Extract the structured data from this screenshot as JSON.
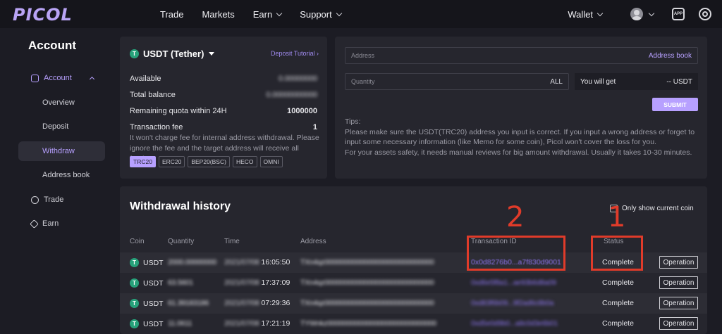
{
  "header": {
    "logo": "PICOL",
    "nav": [
      {
        "label": "Trade",
        "dropdown": false
      },
      {
        "label": "Markets",
        "dropdown": false
      },
      {
        "label": "Earn",
        "dropdown": true
      },
      {
        "label": "Support",
        "dropdown": true
      }
    ],
    "wallet_label": "Wallet",
    "app_icon_text": "APP"
  },
  "sidebar": {
    "title": "Account",
    "account_label": "Account",
    "items": [
      "Overview",
      "Deposit",
      "Withdraw",
      "Address book"
    ],
    "trade_label": "Trade",
    "earn_label": "Earn"
  },
  "coin_panel": {
    "coin": "USDT (Tether)",
    "coin_icon_text": "T",
    "deposit_tutorial": "Deposit Tutorial",
    "available_label": "Available",
    "available_value": "0.00000000",
    "total_balance_label": "Total balance",
    "total_balance_value": "0.00000000000",
    "remaining_quota_label": "Remaining quota within 24H",
    "remaining_quota_value": "1000000",
    "fee_label": "Transaction fee",
    "fee_value": "1",
    "fee_note": "It won't charge fee for internal address withdrawal. Please ignore the fee and the target address will receive all funds.",
    "networks": [
      "TRC20",
      "ERC20",
      "BEP20(BSC)",
      "HECO",
      "OMNI"
    ],
    "selected_network": "TRC20"
  },
  "form": {
    "address_placeholder": "Address",
    "address_book": "Address book",
    "quantity_placeholder": "Quantity",
    "all": "ALL",
    "you_will_get_label": "You will get",
    "you_will_get_value": "-- USDT",
    "submit": "SUBMIT",
    "tips_title": "Tips:",
    "tip1": "Please make sure the USDT(TRC20) address you input is correct. If you input a wrong address or forget to input some necessary information (like Memo for some coin), Picol won't cover the loss for you.",
    "tip2": "For your assets safety, it needs manual reviews for big amount withdrawal. Usually it takes 10-30 minutes."
  },
  "history": {
    "title": "Withdrawal history",
    "only_show_current": "Only show current coin",
    "columns": [
      "Coin",
      "Quantity",
      "Time",
      "Address",
      "Transaction ID",
      "Status"
    ],
    "rows": [
      {
        "coin": "USDT",
        "quantity": "2000.00000000",
        "date": "2021/07/08",
        "time": "16:05:50",
        "address": "TXn4qz0000000000000000000000000000",
        "txid": "0x0d8276b0...a7f830d9001",
        "status": "Complete",
        "op": "Operation"
      },
      {
        "coin": "USDT",
        "quantity": "63.5601",
        "date": "2021/07/08",
        "time": "17:37:09",
        "address": "TXn4qz0000000000000000000000000000",
        "txid": "0xd6e5f8a1...ae93b6d8a09",
        "status": "Complete",
        "op": "Operation"
      },
      {
        "coin": "USDT",
        "quantity": "61.39183186",
        "date": "2021/07/08",
        "time": "07:29:36",
        "address": "TXn4qz0000000000000000000000000000",
        "txid": "0xd83f6b09...9f2ad6c8b0a",
        "status": "Complete",
        "op": "Operation"
      },
      {
        "coin": "USDT",
        "quantity": "11.0611",
        "date": "2021/07/08",
        "time": "17:21:19",
        "address": "TYWnkz0000000000000000000000000000",
        "txid": "0xd5e0d9b0...a8c0d3e6b01",
        "status": "Complete",
        "op": "Operation"
      }
    ]
  },
  "annotations": {
    "num1": "1",
    "num2": "2",
    "color": "#e03b2a"
  }
}
